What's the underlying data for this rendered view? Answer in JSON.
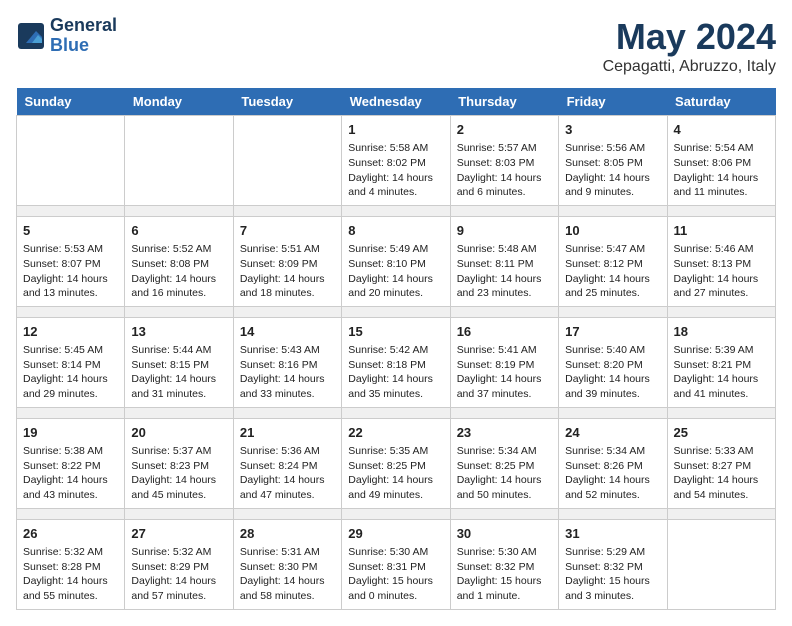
{
  "header": {
    "logo_line1": "General",
    "logo_line2": "Blue",
    "month": "May 2024",
    "location": "Cepagatti, Abruzzo, Italy"
  },
  "weekdays": [
    "Sunday",
    "Monday",
    "Tuesday",
    "Wednesday",
    "Thursday",
    "Friday",
    "Saturday"
  ],
  "weeks": [
    [
      {
        "day": "",
        "info": ""
      },
      {
        "day": "",
        "info": ""
      },
      {
        "day": "",
        "info": ""
      },
      {
        "day": "1",
        "info": "Sunrise: 5:58 AM\nSunset: 8:02 PM\nDaylight: 14 hours\nand 4 minutes."
      },
      {
        "day": "2",
        "info": "Sunrise: 5:57 AM\nSunset: 8:03 PM\nDaylight: 14 hours\nand 6 minutes."
      },
      {
        "day": "3",
        "info": "Sunrise: 5:56 AM\nSunset: 8:05 PM\nDaylight: 14 hours\nand 9 minutes."
      },
      {
        "day": "4",
        "info": "Sunrise: 5:54 AM\nSunset: 8:06 PM\nDaylight: 14 hours\nand 11 minutes."
      }
    ],
    [
      {
        "day": "5",
        "info": "Sunrise: 5:53 AM\nSunset: 8:07 PM\nDaylight: 14 hours\nand 13 minutes."
      },
      {
        "day": "6",
        "info": "Sunrise: 5:52 AM\nSunset: 8:08 PM\nDaylight: 14 hours\nand 16 minutes."
      },
      {
        "day": "7",
        "info": "Sunrise: 5:51 AM\nSunset: 8:09 PM\nDaylight: 14 hours\nand 18 minutes."
      },
      {
        "day": "8",
        "info": "Sunrise: 5:49 AM\nSunset: 8:10 PM\nDaylight: 14 hours\nand 20 minutes."
      },
      {
        "day": "9",
        "info": "Sunrise: 5:48 AM\nSunset: 8:11 PM\nDaylight: 14 hours\nand 23 minutes."
      },
      {
        "day": "10",
        "info": "Sunrise: 5:47 AM\nSunset: 8:12 PM\nDaylight: 14 hours\nand 25 minutes."
      },
      {
        "day": "11",
        "info": "Sunrise: 5:46 AM\nSunset: 8:13 PM\nDaylight: 14 hours\nand 27 minutes."
      }
    ],
    [
      {
        "day": "12",
        "info": "Sunrise: 5:45 AM\nSunset: 8:14 PM\nDaylight: 14 hours\nand 29 minutes."
      },
      {
        "day": "13",
        "info": "Sunrise: 5:44 AM\nSunset: 8:15 PM\nDaylight: 14 hours\nand 31 minutes."
      },
      {
        "day": "14",
        "info": "Sunrise: 5:43 AM\nSunset: 8:16 PM\nDaylight: 14 hours\nand 33 minutes."
      },
      {
        "day": "15",
        "info": "Sunrise: 5:42 AM\nSunset: 8:18 PM\nDaylight: 14 hours\nand 35 minutes."
      },
      {
        "day": "16",
        "info": "Sunrise: 5:41 AM\nSunset: 8:19 PM\nDaylight: 14 hours\nand 37 minutes."
      },
      {
        "day": "17",
        "info": "Sunrise: 5:40 AM\nSunset: 8:20 PM\nDaylight: 14 hours\nand 39 minutes."
      },
      {
        "day": "18",
        "info": "Sunrise: 5:39 AM\nSunset: 8:21 PM\nDaylight: 14 hours\nand 41 minutes."
      }
    ],
    [
      {
        "day": "19",
        "info": "Sunrise: 5:38 AM\nSunset: 8:22 PM\nDaylight: 14 hours\nand 43 minutes."
      },
      {
        "day": "20",
        "info": "Sunrise: 5:37 AM\nSunset: 8:23 PM\nDaylight: 14 hours\nand 45 minutes."
      },
      {
        "day": "21",
        "info": "Sunrise: 5:36 AM\nSunset: 8:24 PM\nDaylight: 14 hours\nand 47 minutes."
      },
      {
        "day": "22",
        "info": "Sunrise: 5:35 AM\nSunset: 8:25 PM\nDaylight: 14 hours\nand 49 minutes."
      },
      {
        "day": "23",
        "info": "Sunrise: 5:34 AM\nSunset: 8:25 PM\nDaylight: 14 hours\nand 50 minutes."
      },
      {
        "day": "24",
        "info": "Sunrise: 5:34 AM\nSunset: 8:26 PM\nDaylight: 14 hours\nand 52 minutes."
      },
      {
        "day": "25",
        "info": "Sunrise: 5:33 AM\nSunset: 8:27 PM\nDaylight: 14 hours\nand 54 minutes."
      }
    ],
    [
      {
        "day": "26",
        "info": "Sunrise: 5:32 AM\nSunset: 8:28 PM\nDaylight: 14 hours\nand 55 minutes."
      },
      {
        "day": "27",
        "info": "Sunrise: 5:32 AM\nSunset: 8:29 PM\nDaylight: 14 hours\nand 57 minutes."
      },
      {
        "day": "28",
        "info": "Sunrise: 5:31 AM\nSunset: 8:30 PM\nDaylight: 14 hours\nand 58 minutes."
      },
      {
        "day": "29",
        "info": "Sunrise: 5:30 AM\nSunset: 8:31 PM\nDaylight: 15 hours\nand 0 minutes."
      },
      {
        "day": "30",
        "info": "Sunrise: 5:30 AM\nSunset: 8:32 PM\nDaylight: 15 hours\nand 1 minute."
      },
      {
        "day": "31",
        "info": "Sunrise: 5:29 AM\nSunset: 8:32 PM\nDaylight: 15 hours\nand 3 minutes."
      },
      {
        "day": "",
        "info": ""
      }
    ]
  ]
}
